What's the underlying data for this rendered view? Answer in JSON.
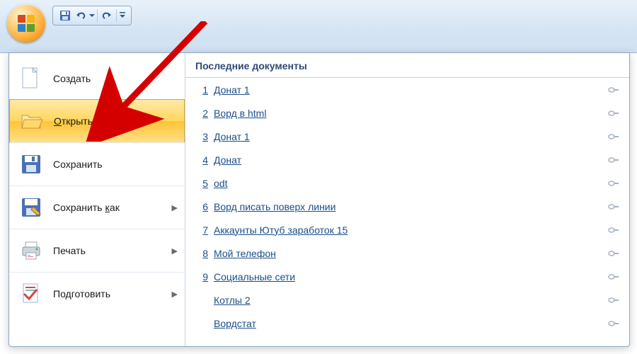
{
  "qat": {
    "save_tip": "Сохранить",
    "undo_tip": "Отменить",
    "redo_tip": "Повторить"
  },
  "menu": {
    "create": "Создать",
    "open": "Открыть",
    "save": "Сохранить",
    "save_as": "Сохранить как",
    "print": "Печать",
    "prepare": "Подготовить",
    "open_accel": "О",
    "save_as_accel": "к"
  },
  "recent": {
    "header": "Последние документы",
    "docs": [
      {
        "index": "1",
        "name": "Донат 1"
      },
      {
        "index": "2",
        "name": "Ворд в html"
      },
      {
        "index": "3",
        "name": "Донат 1"
      },
      {
        "index": "4",
        "name": "Донат"
      },
      {
        "index": "5",
        "name": "odt"
      },
      {
        "index": "6",
        "name": "Ворд писать поверх линии"
      },
      {
        "index": "7",
        "name": "Аккаунты Ютуб заработок 15"
      },
      {
        "index": "8",
        "name": "Мой телефон"
      },
      {
        "index": "9",
        "name": "Социальные сети"
      },
      {
        "index": "",
        "name": "Котлы 2"
      },
      {
        "index": "",
        "name": "Вордстат"
      }
    ]
  }
}
